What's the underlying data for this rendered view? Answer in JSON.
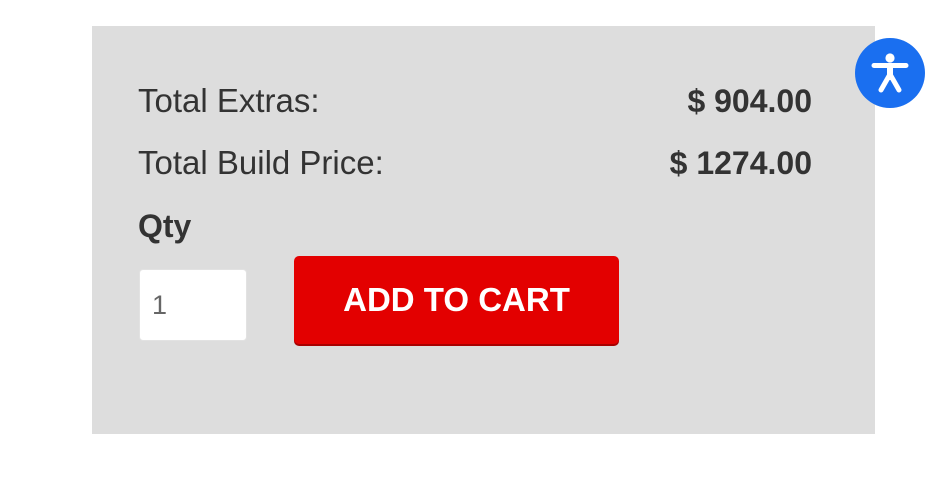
{
  "summary": {
    "total_extras_label": "Total Extras:",
    "total_extras_value": "$ 904.00",
    "total_build_label": "Total Build Price:",
    "total_build_value": "$ 1274.00"
  },
  "quantity": {
    "label": "Qty",
    "value": "1"
  },
  "cart": {
    "add_label": "ADD TO CART"
  },
  "accessibility": {
    "icon": "accessibility-person-icon",
    "color": "#1a6ff0"
  },
  "colors": {
    "panel_background": "#dddddd",
    "button_red": "#e30000",
    "text": "#333333"
  }
}
